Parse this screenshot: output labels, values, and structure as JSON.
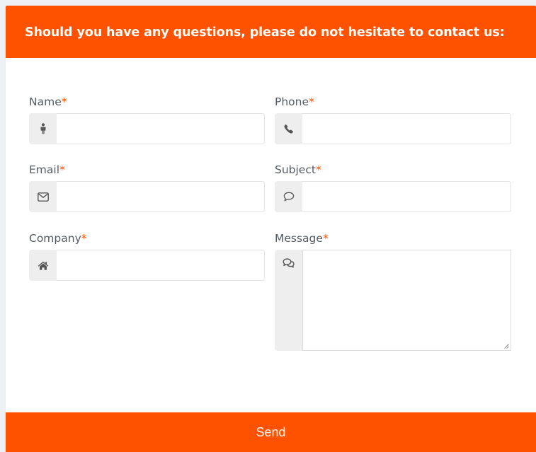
{
  "header": {
    "title": "Should you have any questions, please do not hesitate to contact us:"
  },
  "form": {
    "required_marker": "*",
    "fields": {
      "name": {
        "label": "Name",
        "icon": "user-icon",
        "value": ""
      },
      "phone": {
        "label": "Phone",
        "icon": "phone-icon",
        "value": ""
      },
      "email": {
        "label": "Email",
        "icon": "envelope-icon",
        "value": ""
      },
      "subject": {
        "label": "Subject",
        "icon": "speech-bubble-icon",
        "value": ""
      },
      "company": {
        "label": "Company",
        "icon": "home-icon",
        "value": ""
      },
      "message": {
        "label": "Message",
        "icon": "chat-bubbles-icon",
        "value": ""
      }
    },
    "send_label": "Send"
  },
  "colors": {
    "accent": "#ff5200",
    "label": "#555b63",
    "addon_bg": "#eeeeee",
    "icon": "#555555",
    "page_bg": "#eef1f4"
  }
}
